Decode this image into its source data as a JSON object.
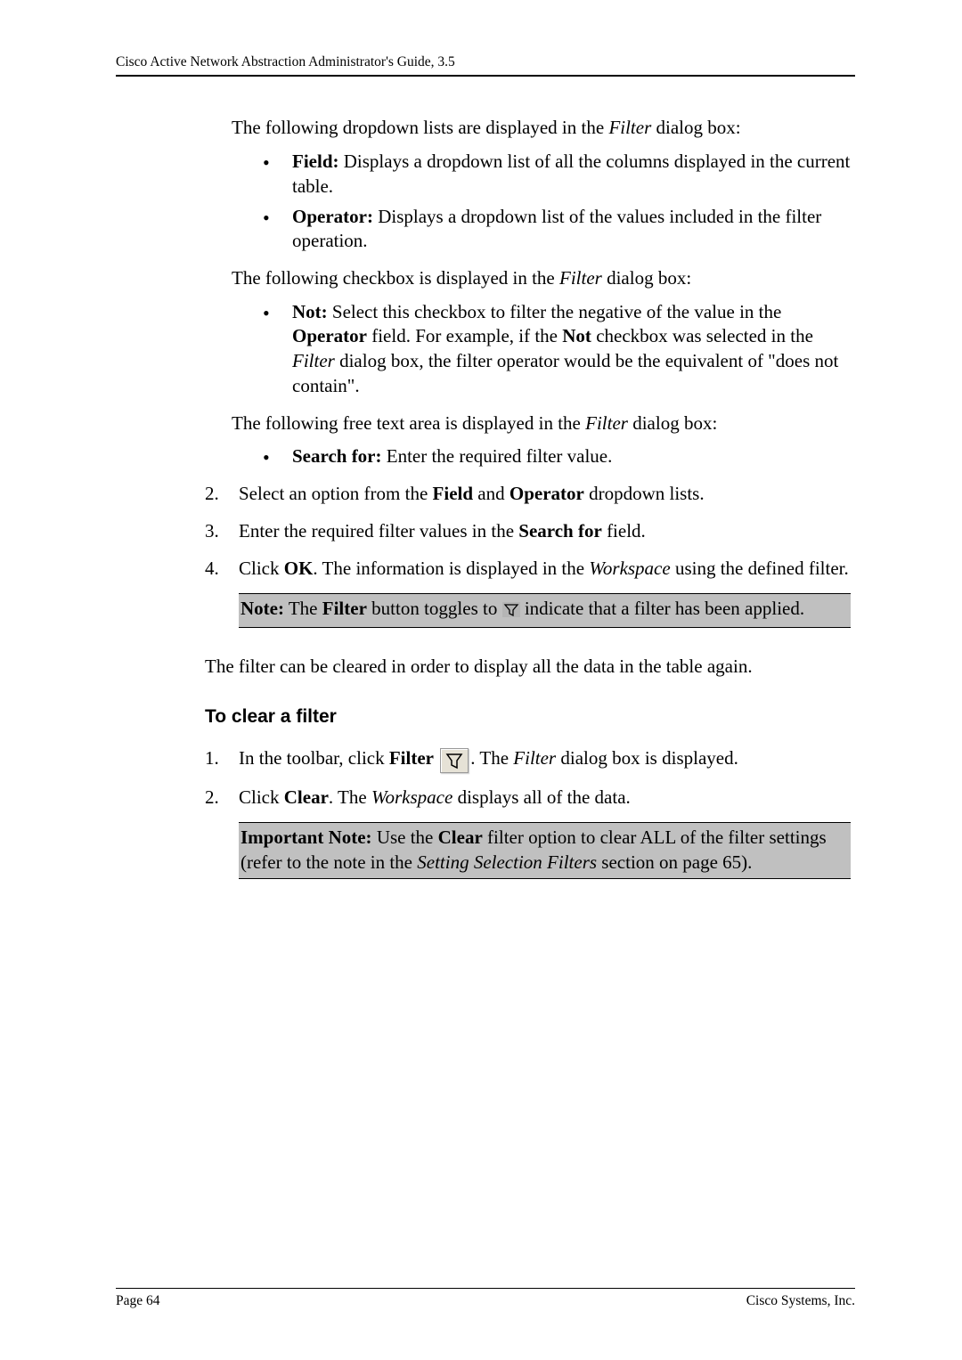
{
  "header": {
    "title": "Cisco Active Network Abstraction Administrator's Guide, 3.5"
  },
  "p_intro1_pre": "The following dropdown lists are displayed in the ",
  "p_intro1_em": "Filter",
  "p_intro1_post": " dialog box:",
  "bullet_field_b": "Field:",
  "bullet_field_t": " Displays a dropdown list of all the columns displayed in the current table.",
  "bullet_operator_b": "Operator:",
  "bullet_operator_t": " Displays a dropdown list of the values included in the filter operation.",
  "p_intro2_pre": "The following checkbox is displayed in the ",
  "p_intro2_em": "Filter",
  "p_intro2_post": " dialog box:",
  "bullet_not_b": "Not:",
  "bullet_not_t1": " Select this checkbox to filter the negative of the value in the ",
  "bullet_not_b2": "Operator",
  "bullet_not_t2": " field. For example, if the ",
  "bullet_not_b3": "Not",
  "bullet_not_t3": " checkbox was selected in the ",
  "bullet_not_em": "Filter",
  "bullet_not_t4": " dialog box, the filter operator would be the equivalent of \"does not contain\".",
  "p_intro3_pre": "The following free text area is displayed in the ",
  "p_intro3_em": "Filter",
  "p_intro3_post": " dialog box:",
  "bullet_search_b": "Search for:",
  "bullet_search_t": " Enter the required filter value.",
  "step2_num": "2.",
  "step2_t1": "Select an option from the ",
  "step2_b1": "Field",
  "step2_t2": " and ",
  "step2_b2": "Operator",
  "step2_t3": " dropdown lists.",
  "step3_num": "3.",
  "step3_t1": "Enter the required filter values in the ",
  "step3_b1": "Search for",
  "step3_t2": " field.",
  "step4_num": "4.",
  "step4_t1": "Click ",
  "step4_b1": "OK",
  "step4_t2": ". The information is displayed in the ",
  "step4_em": "Workspace",
  "step4_t3": " using the defined filter.",
  "note1_b1": "Note:",
  "note1_t1": " The ",
  "note1_b2": "Filter",
  "note1_t2": " button toggles to ",
  "note1_t3": " indicate that a filter has been applied.",
  "clear_intro": "The filter can be cleared in order to display all the data in the table again.",
  "h2": "To clear a filter",
  "c_step1_num": "1.",
  "c_step1_t1": "In the toolbar, click ",
  "c_step1_b1": "Filter",
  "c_step1_t2": ". The ",
  "c_step1_em": "Filter",
  "c_step1_t3": " dialog box is displayed.",
  "c_step2_num": "2.",
  "c_step2_t1": "Click ",
  "c_step2_b1": "Clear",
  "c_step2_t2": ". The ",
  "c_step2_em": "Workspace",
  "c_step2_t3": " displays all of the data.",
  "note2_b1": "Important Note:",
  "note2_t1": " Use the ",
  "note2_b2": "Clear",
  "note2_t2": " filter option to clear ALL of the filter settings (refer to the note in the ",
  "note2_em": "Setting Selection Filters",
  "note2_t3": " section on page 65).",
  "footer": {
    "page": "Page 64",
    "company": "Cisco Systems, Inc."
  }
}
